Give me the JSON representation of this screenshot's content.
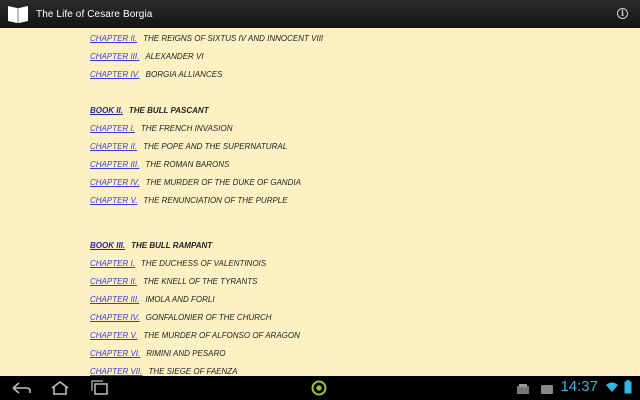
{
  "app": {
    "title": "The Life of Cesare Borgia",
    "icon": "book-icon",
    "menu_icon": "info-icon"
  },
  "toc": [
    {
      "type": "chapter",
      "label": "CHAPTER II.",
      "title": "THE REIGNS OF SIXTUS IV AND INNOCENT VIII"
    },
    {
      "type": "chapter",
      "label": "CHAPTER III.",
      "title": "ALEXANDER VI"
    },
    {
      "type": "chapter",
      "label": "CHAPTER IV.",
      "title": "BORGIA ALLIANCES"
    },
    {
      "type": "book",
      "label": "BOOK II.",
      "title": "THE BULL PASCANT"
    },
    {
      "type": "chapter",
      "label": "CHAPTER I.",
      "title": "THE FRENCH INVASION"
    },
    {
      "type": "chapter",
      "label": "CHAPTER II.",
      "title": "THE POPE AND THE SUPERNATURAL"
    },
    {
      "type": "chapter",
      "label": "CHAPTER III.",
      "title": "THE ROMAN BARONS"
    },
    {
      "type": "chapter",
      "label": "CHAPTER IV.",
      "title": "THE MURDER OF THE DUKE OF GANDIA"
    },
    {
      "type": "chapter",
      "label": "CHAPTER V.",
      "title": "THE RENUNCIATION OF THE PURPLE"
    },
    {
      "type": "book",
      "label": "BOOK III.",
      "title": "THE BULL RAMPANT"
    },
    {
      "type": "chapter",
      "label": "CHAPTER I.",
      "title": "THE DUCHESS OF VALENTINOIS"
    },
    {
      "type": "chapter",
      "label": "CHAPTER II.",
      "title": "THE KNELL OF THE TYRANTS"
    },
    {
      "type": "chapter",
      "label": "CHAPTER III.",
      "title": "IMOLA AND FORLI"
    },
    {
      "type": "chapter",
      "label": "CHAPTER IV.",
      "title": "GONFALONIER OF THE CHURCH"
    },
    {
      "type": "chapter",
      "label": "CHAPTER V.",
      "title": "THE MURDER OF ALFONSO OF ARAGON"
    },
    {
      "type": "chapter",
      "label": "CHAPTER VI.",
      "title": "RIMINI AND PESARO"
    },
    {
      "type": "chapter",
      "label": "CHAPTER VII.",
      "title": "THE SIEGE OF FAENZA"
    }
  ],
  "navbar": {
    "back_icon": "back-icon",
    "home_icon": "home-icon",
    "recents_icon": "recents-icon",
    "center_icon": "notification-ring-icon"
  },
  "status": {
    "time": "14:37",
    "accent": "#33b5e5",
    "wifi_icon": "wifi-icon",
    "battery_icon": "battery-icon"
  }
}
